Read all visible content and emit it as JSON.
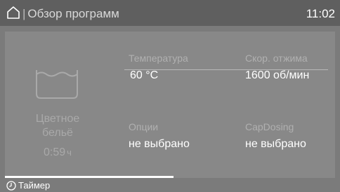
{
  "header": {
    "icon": "home-icon",
    "title": "Обзор программ",
    "time": "11:02"
  },
  "program": {
    "icon": "washbasin-icon",
    "name_line1": "Цветное",
    "name_line2": "бельё",
    "duration": "0:59",
    "duration_unit": "ч"
  },
  "params": {
    "temperature": {
      "label": "Температура",
      "value": "60 °C"
    },
    "spin": {
      "label": "Скор. отжима",
      "value": "1600 об/мин"
    },
    "options": {
      "label": "Опции",
      "value": "не выбрано"
    },
    "capdosing": {
      "label": "CapDosing",
      "value": "не выбрано"
    }
  },
  "progress": {
    "fraction": 0.51
  },
  "footer": {
    "icon": "timer-icon",
    "timer_label": "Таймер"
  },
  "colors": {
    "background": "#7b7b7b",
    "header": "#5f5f5f",
    "panel": "#888888"
  }
}
